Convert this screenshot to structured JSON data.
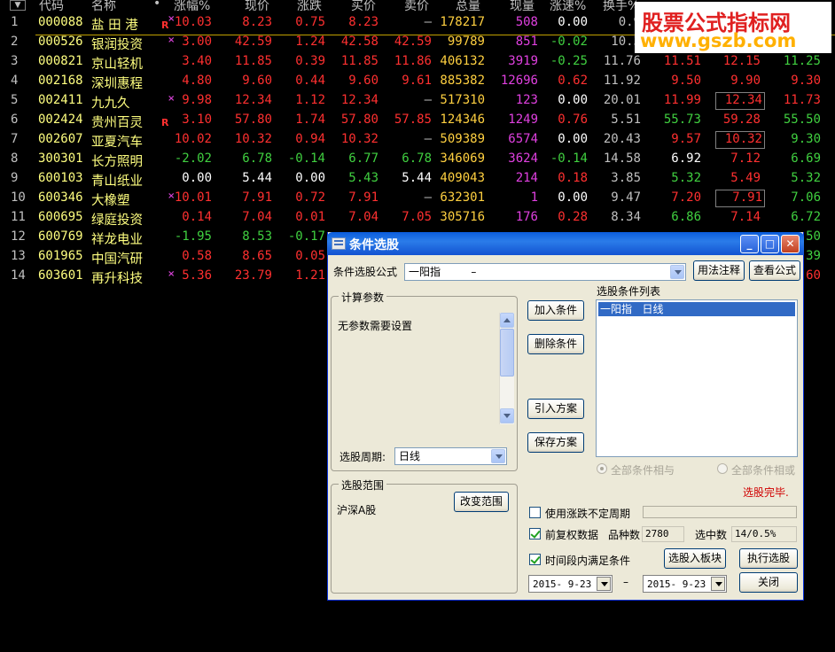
{
  "watermark": {
    "line1": "股票公式指标网",
    "line2": "www.gszb.com"
  },
  "table": {
    "headers": [
      "代码",
      "名称",
      "•",
      "涨幅%",
      "现价",
      "涨跌",
      "买价",
      "卖价",
      "总量",
      "现量",
      "涨速%",
      "换手%"
    ],
    "rows": [
      {
        "no": "1",
        "code": "000088",
        "name": "盐 田 港",
        "mark": "R",
        "x": true,
        "chg": "10.03",
        "price": "8.23",
        "diff": "0.75",
        "bid": "8.23",
        "ask": "—",
        "vol": "178217",
        "cur": "508",
        "speed": "0.00",
        "turn": "0.9",
        "c1": "",
        "c2": "",
        "c3": "",
        "chgc": "#ff3030",
        "pc": "#ff3030",
        "dc": "#ff3030",
        "bc": "#ff3030",
        "ac": "#c0c0c0",
        "c1c": "#ff3030",
        "c2c": "#ff3030",
        "c3c": "#ff3030",
        "box": false
      },
      {
        "no": "2",
        "code": "000526",
        "name": "银润投资",
        "mark": "",
        "x": true,
        "chg": "3.00",
        "price": "42.59",
        "diff": "1.24",
        "bid": "42.58",
        "ask": "42.59",
        "vol": "99789",
        "cur": "851",
        "speed": "-0.02",
        "turn": "10.3",
        "c1": "",
        "c2": "",
        "c3": "",
        "chgc": "#ff3030",
        "pc": "#ff3030",
        "dc": "#ff3030",
        "bc": "#ff3030",
        "ac": "#ff3030",
        "c1c": "#ff3030",
        "c2c": "#ff3030",
        "c3c": "#ff3030",
        "box": false
      },
      {
        "no": "3",
        "code": "000821",
        "name": "京山轻机",
        "mark": "",
        "x": false,
        "chg": "3.40",
        "price": "11.85",
        "diff": "0.39",
        "bid": "11.85",
        "ask": "11.86",
        "vol": "406132",
        "cur": "3919",
        "speed": "-0.25",
        "turn": "11.76",
        "c1": "11.51",
        "c2": "12.15",
        "c3": "11.25",
        "chgc": "#ff3030",
        "pc": "#ff3030",
        "dc": "#ff3030",
        "bc": "#ff3030",
        "ac": "#ff3030",
        "c1c": "#ff3030",
        "c2c": "#ff3030",
        "c3c": "#40d040",
        "box": false
      },
      {
        "no": "4",
        "code": "002168",
        "name": "深圳惠程",
        "mark": "",
        "x": false,
        "chg": "4.80",
        "price": "9.60",
        "diff": "0.44",
        "bid": "9.60",
        "ask": "9.61",
        "vol": "885382",
        "cur": "12696",
        "speed": "0.62",
        "turn": "11.92",
        "c1": "9.50",
        "c2": "9.90",
        "c3": "9.30",
        "chgc": "#ff3030",
        "pc": "#ff3030",
        "dc": "#ff3030",
        "bc": "#ff3030",
        "ac": "#ff3030",
        "c1c": "#ff3030",
        "c2c": "#ff3030",
        "c3c": "#ff3030",
        "box": false
      },
      {
        "no": "5",
        "code": "002411",
        "name": "九九久",
        "mark": "",
        "x": true,
        "chg": "9.98",
        "price": "12.34",
        "diff": "1.12",
        "bid": "12.34",
        "ask": "—",
        "vol": "517310",
        "cur": "123",
        "speed": "0.00",
        "turn": "20.01",
        "c1": "11.99",
        "c2": "12.34",
        "c3": "11.73",
        "chgc": "#ff3030",
        "pc": "#ff3030",
        "dc": "#ff3030",
        "bc": "#ff3030",
        "ac": "#c0c0c0",
        "c1c": "#ff3030",
        "c2c": "#ff3030",
        "c3c": "#ff3030",
        "box": true
      },
      {
        "no": "6",
        "code": "002424",
        "name": "贵州百灵",
        "mark": "R",
        "x": false,
        "chg": "3.10",
        "price": "57.80",
        "diff": "1.74",
        "bid": "57.80",
        "ask": "57.85",
        "vol": "124346",
        "cur": "1249",
        "speed": "0.76",
        "turn": "5.51",
        "c1": "55.73",
        "c2": "59.28",
        "c3": "55.50",
        "chgc": "#ff3030",
        "pc": "#ff3030",
        "dc": "#ff3030",
        "bc": "#ff3030",
        "ac": "#ff3030",
        "c1c": "#40d040",
        "c2c": "#ff3030",
        "c3c": "#40d040",
        "box": false
      },
      {
        "no": "7",
        "code": "002607",
        "name": "亚夏汽车",
        "mark": "",
        "x": false,
        "chg": "10.02",
        "price": "10.32",
        "diff": "0.94",
        "bid": "10.32",
        "ask": "—",
        "vol": "509389",
        "cur": "6574",
        "speed": "0.00",
        "turn": "20.43",
        "c1": "9.57",
        "c2": "10.32",
        "c3": "9.30",
        "chgc": "#ff3030",
        "pc": "#ff3030",
        "dc": "#ff3030",
        "bc": "#ff3030",
        "ac": "#c0c0c0",
        "c1c": "#ff3030",
        "c2c": "#ff3030",
        "c3c": "#40d040",
        "box": true
      },
      {
        "no": "8",
        "code": "300301",
        "name": "长方照明",
        "mark": "",
        "x": false,
        "chg": "-2.02",
        "price": "6.78",
        "diff": "-0.14",
        "bid": "6.77",
        "ask": "6.78",
        "vol": "346069",
        "cur": "3624",
        "speed": "-0.14",
        "turn": "14.58",
        "c1": "6.92",
        "c2": "7.12",
        "c3": "6.69",
        "chgc": "#40d040",
        "pc": "#40d040",
        "dc": "#40d040",
        "bc": "#40d040",
        "ac": "#40d040",
        "c1c": "#ffffff",
        "c2c": "#ff3030",
        "c3c": "#40d040",
        "box": false
      },
      {
        "no": "9",
        "code": "600103",
        "name": "青山纸业",
        "mark": "",
        "x": false,
        "chg": "0.00",
        "price": "5.44",
        "diff": "0.00",
        "bid": "5.43",
        "ask": "5.44",
        "vol": "409043",
        "cur": "214",
        "speed": "0.18",
        "turn": "3.85",
        "c1": "5.32",
        "c2": "5.49",
        "c3": "5.32",
        "chgc": "#ffffff",
        "pc": "#ffffff",
        "dc": "#ffffff",
        "bc": "#40d040",
        "ac": "#ffffff",
        "c1c": "#40d040",
        "c2c": "#ff3030",
        "c3c": "#40d040",
        "box": false
      },
      {
        "no": "10",
        "code": "600346",
        "name": "大橡塑",
        "mark": "",
        "x": true,
        "chg": "10.01",
        "price": "7.91",
        "diff": "0.72",
        "bid": "7.91",
        "ask": "—",
        "vol": "632301",
        "cur": "1",
        "speed": "0.00",
        "turn": "9.47",
        "c1": "7.20",
        "c2": "7.91",
        "c3": "7.06",
        "chgc": "#ff3030",
        "pc": "#ff3030",
        "dc": "#ff3030",
        "bc": "#ff3030",
        "ac": "#c0c0c0",
        "c1c": "#ff3030",
        "c2c": "#ff3030",
        "c3c": "#40d040",
        "box": true
      },
      {
        "no": "11",
        "code": "600695",
        "name": "绿庭投资",
        "mark": "",
        "x": false,
        "chg": "0.14",
        "price": "7.04",
        "diff": "0.01",
        "bid": "7.04",
        "ask": "7.05",
        "vol": "305716",
        "cur": "176",
        "speed": "0.28",
        "turn": "8.34",
        "c1": "6.86",
        "c2": "7.14",
        "c3": "6.72",
        "chgc": "#ff3030",
        "pc": "#ff3030",
        "dc": "#ff3030",
        "bc": "#ff3030",
        "ac": "#ff3030",
        "c1c": "#40d040",
        "c2c": "#ff3030",
        "c3c": "#40d040",
        "box": false
      },
      {
        "no": "12",
        "code": "600769",
        "name": "祥龙电业",
        "mark": "",
        "x": false,
        "chg": "-1.95",
        "price": "8.53",
        "diff": "-0.17",
        "bid": "",
        "ask": "",
        "vol": "",
        "cur": "",
        "speed": "",
        "turn": "",
        "c1": "",
        "c2": "",
        "c3": ".50",
        "chgc": "#40d040",
        "pc": "#40d040",
        "dc": "#40d040",
        "bc": "#40d040",
        "ac": "#40d040",
        "c1c": "#40d040",
        "c2c": "#40d040",
        "c3c": "#40d040",
        "box": false
      },
      {
        "no": "13",
        "code": "601965",
        "name": "中国汽研",
        "mark": "",
        "x": false,
        "chg": "0.58",
        "price": "8.65",
        "diff": "0.05",
        "bid": "",
        "ask": "",
        "vol": "",
        "cur": "",
        "speed": "",
        "turn": "",
        "c1": "",
        "c2": "",
        "c3": ".39",
        "chgc": "#ff3030",
        "pc": "#ff3030",
        "dc": "#ff3030",
        "bc": "#ff3030",
        "ac": "#ff3030",
        "c1c": "#40d040",
        "c2c": "#40d040",
        "c3c": "#40d040",
        "box": false
      },
      {
        "no": "14",
        "code": "603601",
        "name": "再升科技",
        "mark": "",
        "x": true,
        "chg": "5.36",
        "price": "23.79",
        "diff": "1.21",
        "bid": "",
        "ask": "",
        "vol": "",
        "cur": "",
        "speed": "",
        "turn": "",
        "c1": "",
        "c2": "",
        "c3": ".60",
        "chgc": "#ff3030",
        "pc": "#ff3030",
        "dc": "#ff3030",
        "bc": "#ff3030",
        "ac": "#ff3030",
        "c1c": "#ff3030",
        "c2c": "#ff3030",
        "c3c": "#ff3030",
        "box": false
      }
    ]
  },
  "dialog": {
    "title": "条件选股",
    "formula_label": "条件选股公式",
    "formula_value": "一阳指         –",
    "usage_btn": "用法注释",
    "view_btn": "查看公式",
    "params_group": "计算参数",
    "params_text": "无参数需要设置",
    "period_label": "选股周期:",
    "period_value": "日线",
    "add_btn": "加入条件",
    "del_btn": "删除条件",
    "import_btn": "引入方案",
    "save_btn": "保存方案",
    "list_label": "选股条件列表",
    "list_item": "一阳指   日线",
    "radio_and": "全部条件相与",
    "radio_or": "全部条件相或",
    "status": "选股完毕.",
    "range_group": "选股范围",
    "range_value": "沪深A股",
    "change_range_btn": "改变范围",
    "use_uncertain_period": "使用涨跌不定周期",
    "pre_adjust": "前复权数据",
    "variety_label": "品种数",
    "variety_value": "2780",
    "selected_label": "选中数",
    "selected_value": "14/0.5%",
    "time_range": "时间段内满足条件",
    "to_block_btn": "选股入板块",
    "execute_btn": "执行选股",
    "date_from": "2015- 9-23",
    "date_sep": "–",
    "date_to": "2015- 9-23",
    "close_btn": "关闭"
  }
}
